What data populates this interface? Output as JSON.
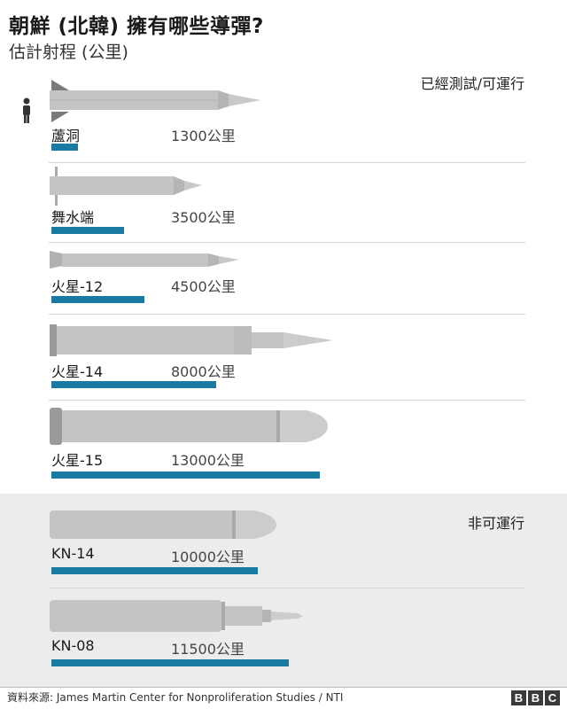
{
  "title": "朝鮮 (北韓) 擁有哪些導彈?",
  "subtitle": "估計射程 (公里)",
  "label_operational": "已經測試/可運行",
  "label_nonoperational": "非可運行",
  "source": "資料來源: James Martin Center for Nonproliferation Studies / NTI",
  "logo": [
    "B",
    "B",
    "C"
  ],
  "colors": {
    "bar": "#1a7aa0",
    "missile_body": "#c4c4c4",
    "missile_dark": "#8e8e8e",
    "panel": "#ececec"
  },
  "chart_data": {
    "type": "bar",
    "categories": [
      "蘆洞",
      "舞水端",
      "火星-12",
      "火星-14",
      "火星-15",
      "KN-14",
      "KN-08"
    ],
    "values": [
      1300,
      3500,
      4500,
      8000,
      13000,
      10000,
      11500
    ],
    "range_labels": [
      "1300公里",
      "3500公里",
      "4500公里",
      "8000公里",
      "13000公里",
      "10000公里",
      "11500公里"
    ],
    "status": [
      "operational",
      "operational",
      "operational",
      "operational",
      "operational",
      "non-operational",
      "non-operational"
    ],
    "title": "朝鮮 (北韓) 擁有哪些導彈?",
    "subtitle": "估計射程 (公里)",
    "unit": "公里"
  }
}
